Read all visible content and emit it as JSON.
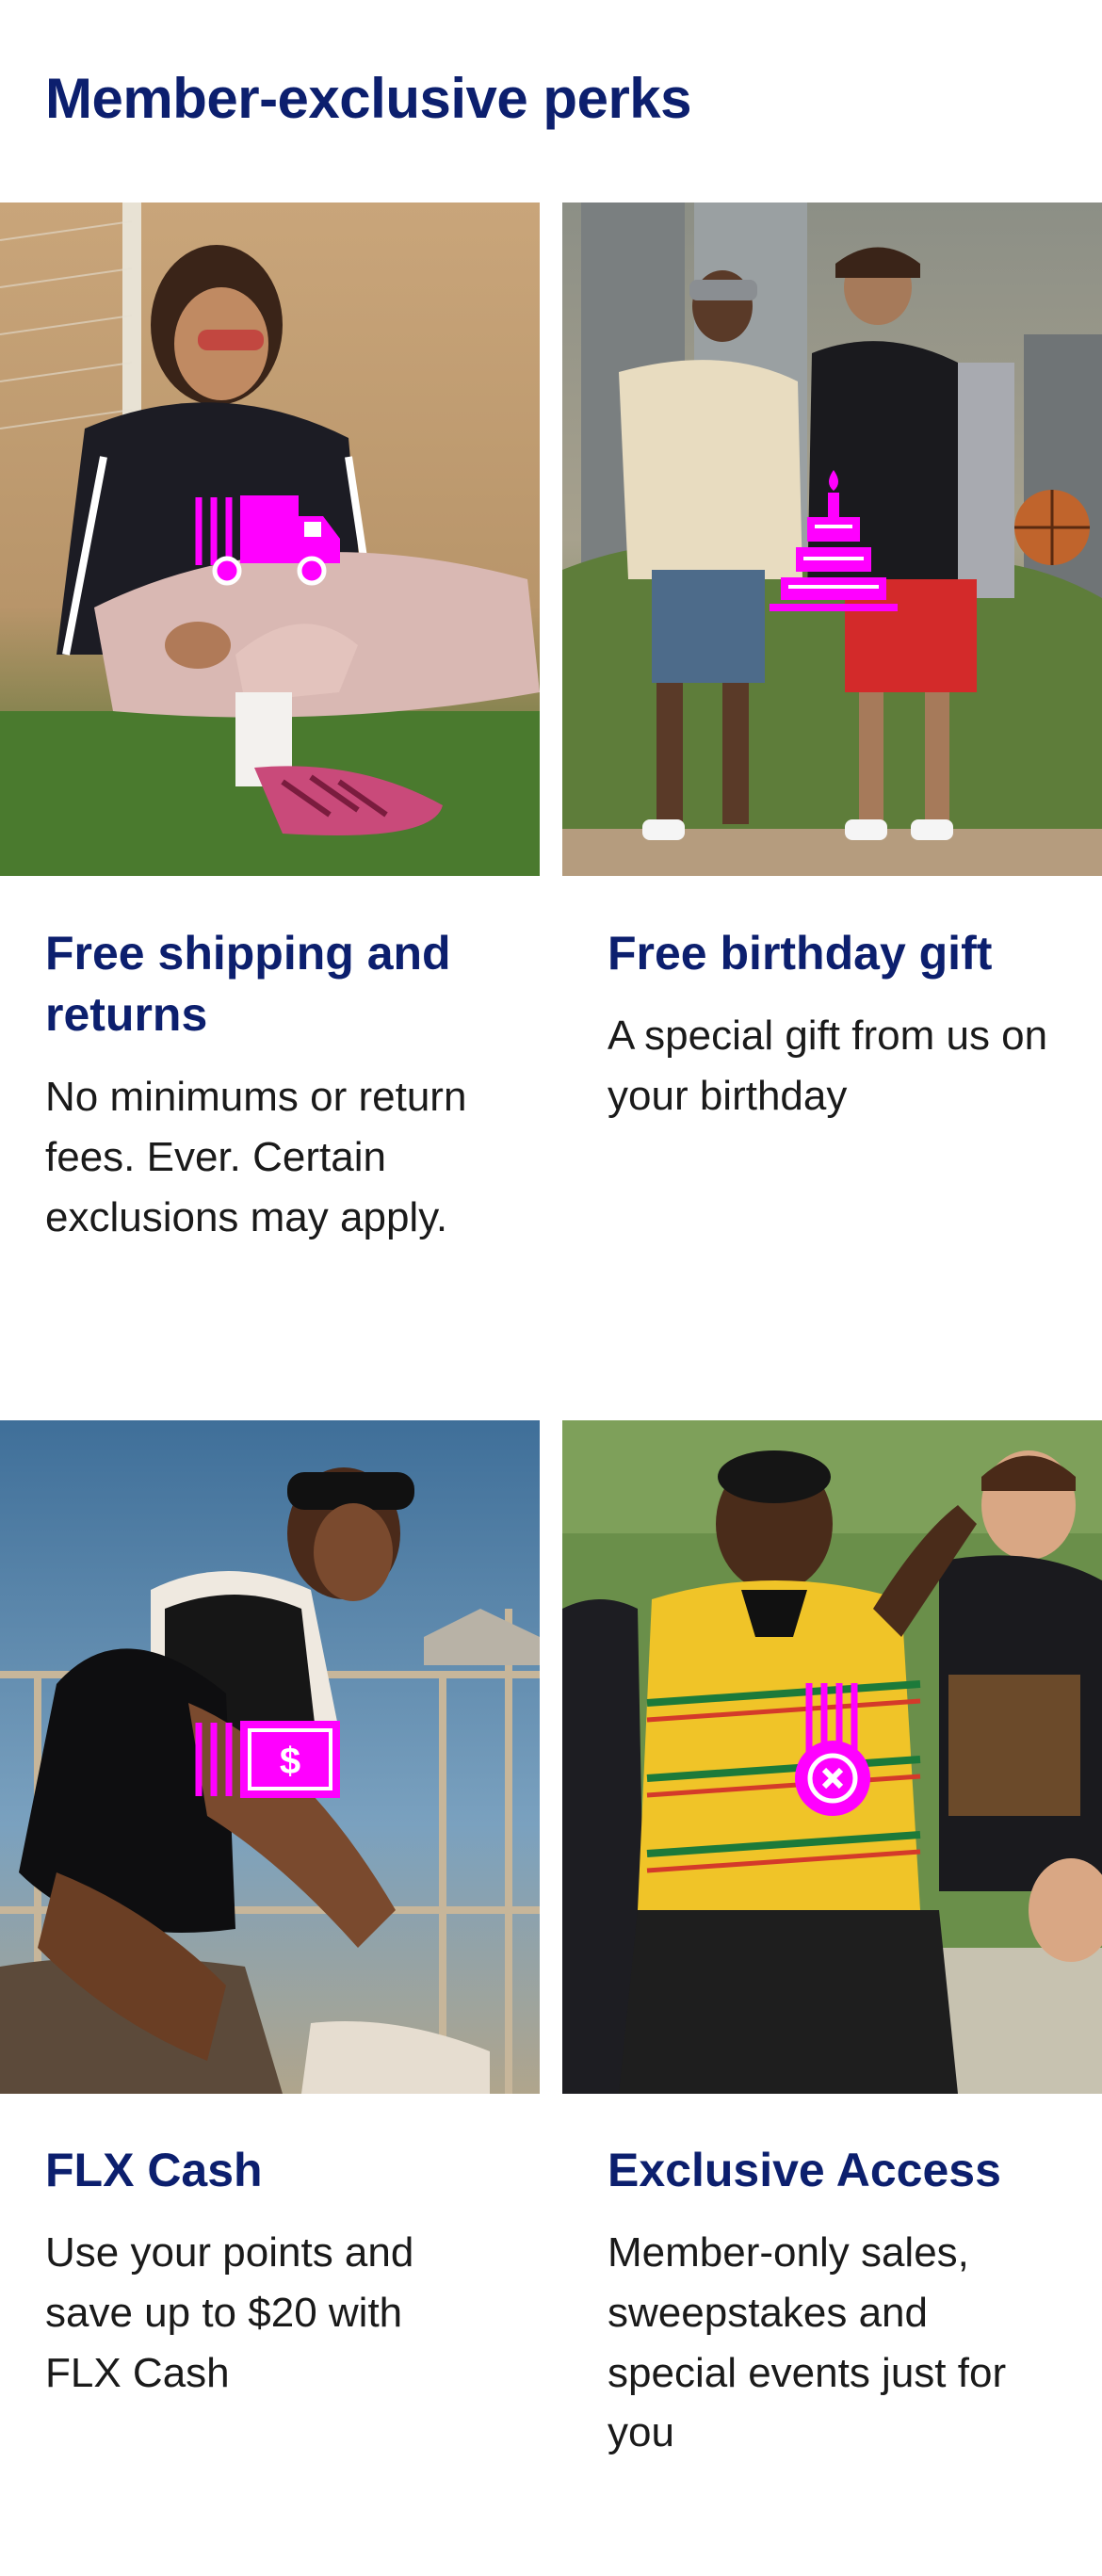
{
  "header": {
    "title": "Member-exclusive perks"
  },
  "accent_color": "#ff00ff",
  "title_color": "#0c1f6e",
  "perks": [
    {
      "title": "Free shipping and returns",
      "description": "No minimums or return fees. Ever. Certain exclusions may apply.",
      "icon": "truck-icon"
    },
    {
      "title": "Free birthday gift",
      "description": "A special gift from us on your birthday",
      "icon": "birthday-cake-icon"
    },
    {
      "title": "FLX Cash",
      "description": "Use your points and save up to $20 with FLX Cash",
      "icon": "cash-icon"
    },
    {
      "title": "Exclusive Access",
      "description": "Member-only sales, sweepstakes and special events just for you",
      "icon": "access-badge-icon"
    }
  ]
}
